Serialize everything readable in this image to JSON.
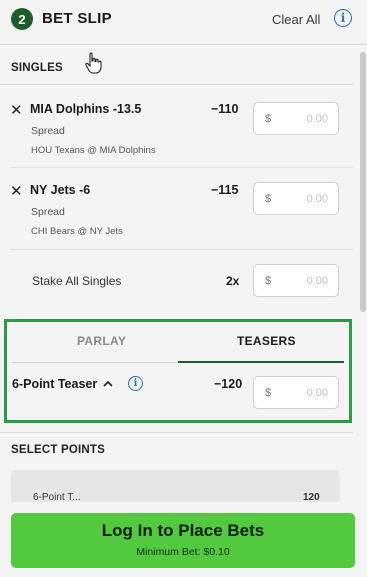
{
  "header": {
    "count": "2",
    "title": "BET SLIP",
    "clear_all": "Clear All",
    "info_icon": "info-icon"
  },
  "singles": {
    "label": "SINGLES",
    "bets": [
      {
        "name": "MIA Dolphins -13.5",
        "odds": "−110",
        "type": "Spread",
        "match": "HOU Texans @ MIA Dolphins",
        "stake_currency": "$",
        "stake_placeholder": "0.00"
      },
      {
        "name": "NY Jets -6",
        "odds": "−115",
        "type": "Spread",
        "match": "CHI Bears @ NY Jets",
        "stake_currency": "$",
        "stake_placeholder": "0.00"
      }
    ],
    "stake_all": {
      "label": "Stake All Singles",
      "multiplier": "2x",
      "currency": "$",
      "placeholder": "0.00"
    }
  },
  "parlay": {
    "tabs": [
      {
        "label": "PARLAY",
        "active": false
      },
      {
        "label": "TEASERS",
        "active": true
      }
    ],
    "teaser": {
      "name": "6-Point Teaser",
      "odds": "−120",
      "currency": "$",
      "placeholder": "0.00"
    }
  },
  "select_points": {
    "label": "SELECT POINTS",
    "row_text": "6-Point T...",
    "row_value": "120"
  },
  "footer": {
    "button_label": "Log In to Place Bets",
    "min_bet": "Minimum Bet: $0.10"
  },
  "colors": {
    "accent_green": "#52c93f",
    "badge_green": "#1f5c2c",
    "highlight_border": "#2e9a48",
    "info_blue": "#2a6fb8"
  }
}
